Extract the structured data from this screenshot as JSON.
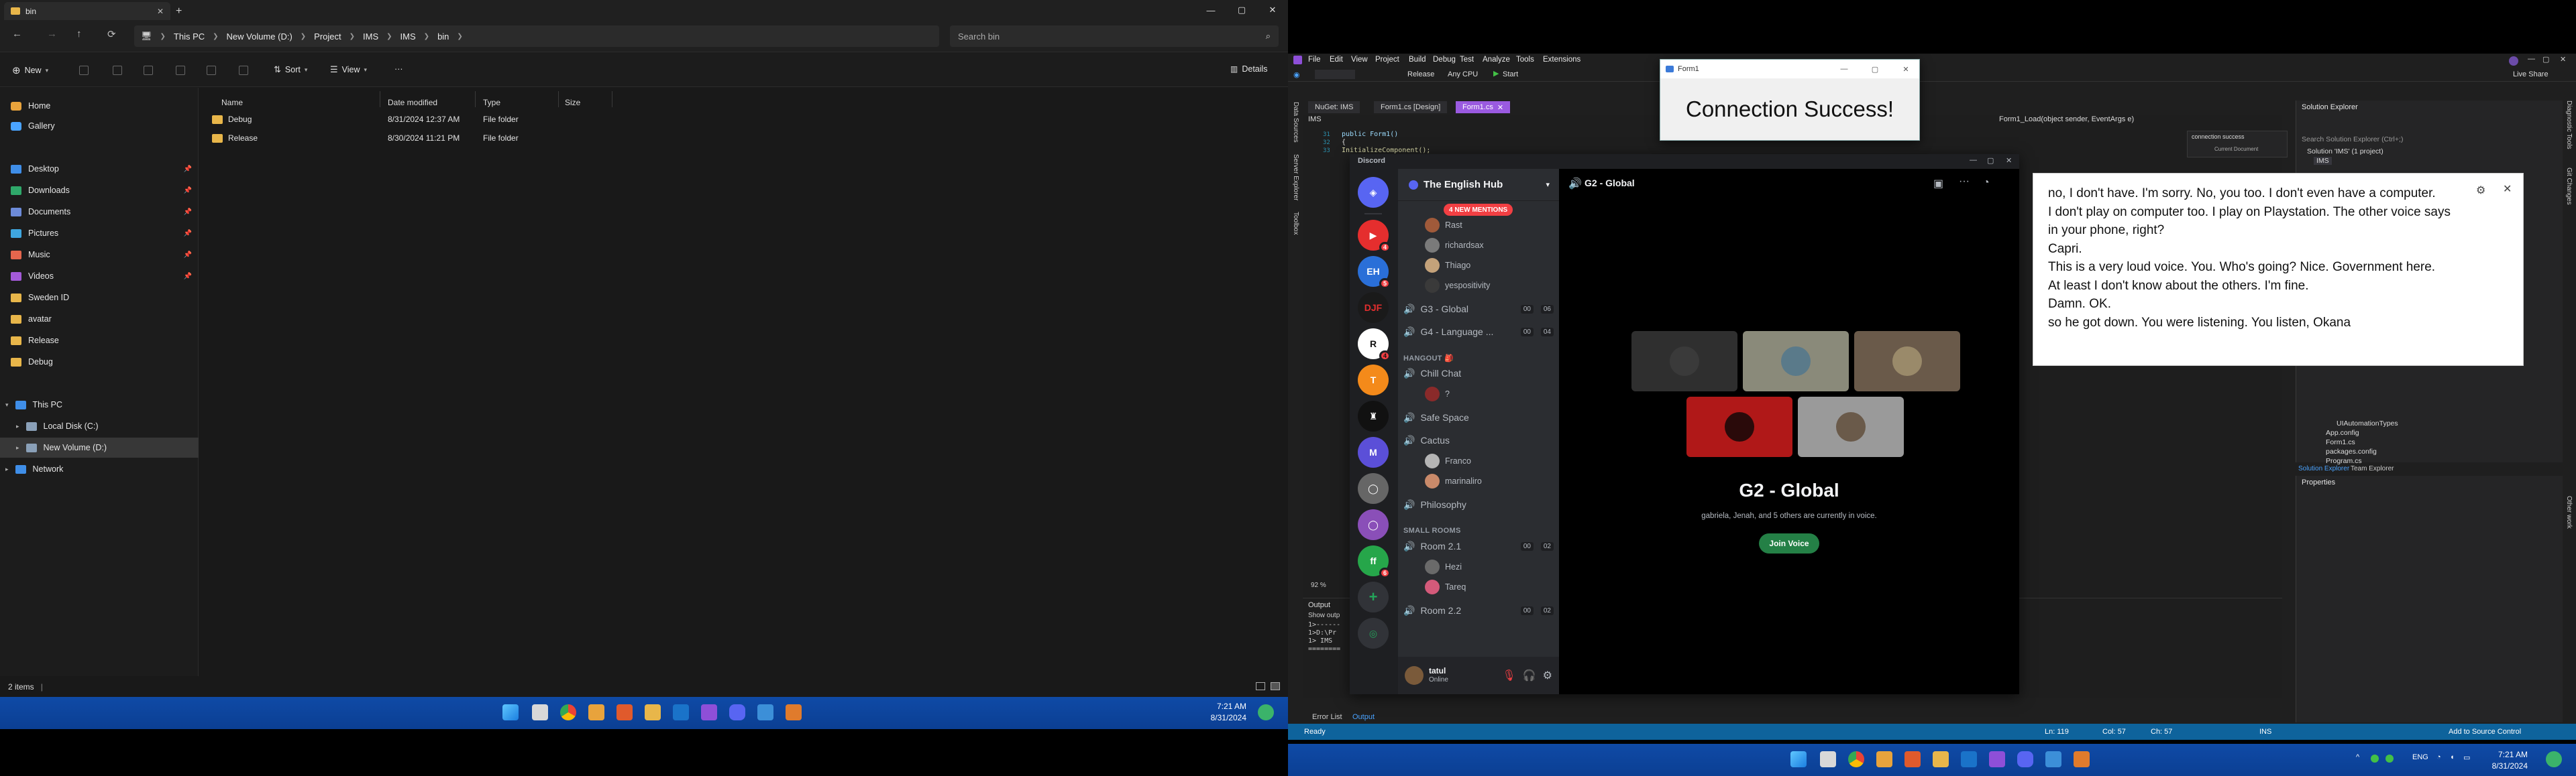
{
  "explorer": {
    "tab_title": "bin",
    "breadcrumbs": [
      "This PC",
      "New Volume (D:)",
      "Project",
      "IMS",
      "IMS",
      "bin"
    ],
    "search_placeholder": "Search bin",
    "toolbar": {
      "new": "New",
      "sort": "Sort",
      "view": "View",
      "more": "···",
      "details": "Details"
    },
    "sidebar": {
      "quick": [
        {
          "label": "Home",
          "color": "#e8a33c",
          "pinned": false
        },
        {
          "label": "Gallery",
          "color": "#4aa3ff",
          "pinned": false
        }
      ],
      "pinned": [
        {
          "label": "Desktop",
          "color": "#3f8ee8",
          "pinned": true
        },
        {
          "label": "Downloads",
          "color": "#2fa86a",
          "pinned": true
        },
        {
          "label": "Documents",
          "color": "#6d8bd9",
          "pinned": true
        },
        {
          "label": "Pictures",
          "color": "#3fa6df",
          "pinned": true
        },
        {
          "label": "Music",
          "color": "#e4664d",
          "pinned": true
        },
        {
          "label": "Videos",
          "color": "#a35ad8",
          "pinned": true
        },
        {
          "label": "Sweden ID",
          "color": "#e8b64a",
          "pinned": false
        },
        {
          "label": "avatar",
          "color": "#e8b64a",
          "pinned": false
        },
        {
          "label": "Release",
          "color": "#e8b64a",
          "pinned": false
        },
        {
          "label": "Debug",
          "color": "#e8b64a",
          "pinned": false
        }
      ],
      "tree": [
        {
          "label": "This PC",
          "level": 0
        },
        {
          "label": "Local Disk (C:)",
          "level": 1
        },
        {
          "label": "New Volume (D:)",
          "level": 1
        },
        {
          "label": "Network",
          "level": 0
        }
      ]
    },
    "columns": [
      "Name",
      "Date modified",
      "Type",
      "Size"
    ],
    "files": [
      {
        "name": "Debug",
        "date": "8/31/2024 12:37 AM",
        "type": "File folder",
        "size": ""
      },
      {
        "name": "Release",
        "date": "8/30/2024 11:21 PM",
        "type": "File folder",
        "size": ""
      }
    ],
    "status": "2 items"
  },
  "taskbar_left": {
    "time": "7:21 AM",
    "date": "8/31/2024"
  },
  "taskbar_right": {
    "time": "7:21 AM",
    "date": "8/31/2024",
    "lang": "ENG"
  },
  "vs": {
    "menus": [
      "File",
      "Edit",
      "View",
      "Project",
      "Build",
      "Debug",
      "Test",
      "Analyze",
      "Tools",
      "Extensions"
    ],
    "toolbar": {
      "config": "Release",
      "platform": "Any CPU",
      "start": "Start",
      "live_share": "Live Share"
    },
    "doc_tabs": [
      "NuGet: IMS",
      "Form1.cs [Design]",
      "Form1.cs"
    ],
    "class_dropdown": "IMS",
    "method_dropdown": "Form1_Load(object sender, EventArgs e)",
    "code_lines": [
      "public Form1()",
      "{",
      "    InitializeComponent();"
    ],
    "line_numbers": [
      "31",
      "32",
      "33"
    ],
    "zoom": "92 %",
    "output_title": "Output",
    "output_show": "Show outp",
    "output_lines": [
      "1>------",
      "1>D:\\Pr",
      "1>  IMS",
      "========"
    ],
    "bottom_tabs": [
      "Error List",
      "Output"
    ],
    "solution": {
      "title": "Solution Explorer",
      "search": "Search Solution Explorer (Ctrl+;)",
      "root": "Solution 'IMS' (1 project)",
      "project": "IMS",
      "items": [
        "UIAutomationTypes",
        "App.config",
        "Form1.cs",
        "packages.config",
        "Program.cs"
      ],
      "tabs": [
        "Solution Explorer",
        "Team Explorer"
      ]
    },
    "find": {
      "text": "connection success",
      "scope": "Current Document"
    },
    "properties_title": "Properties",
    "status": {
      "ready": "Ready",
      "ln": "Ln: 119",
      "col": "Col: 57",
      "ch": "Ch: 57",
      "ins": "INS",
      "source": "Add to Source Control"
    },
    "side_tabs": [
      "Data Sources",
      "Server Explorer",
      "Toolbox"
    ],
    "right_side_tabs": [
      "Diagnostic Tools",
      "Git Changes",
      "Other work"
    ]
  },
  "form1": {
    "title": "Form1",
    "message": "Connection Success!"
  },
  "discord": {
    "app_title": "Discord",
    "server_name": "The English Hub",
    "new_mentions": "4 NEW MENTIONS",
    "top_users": [
      "Rast",
      "richardsax",
      "Thiago",
      "yespositivity"
    ],
    "channels": [
      {
        "name": "G3 - Global",
        "a": "00",
        "b": "06"
      },
      {
        "name": "G4 - Language ...",
        "a": "00",
        "b": "04"
      }
    ],
    "category_hangout": "HANGOUT 🎒",
    "chill_chat": "Chill Chat",
    "chill_user": "?",
    "safe_space": "Safe Space",
    "cactus": "Cactus",
    "cactus_users": [
      "Franco",
      "marinaliro"
    ],
    "philosophy": "Philosophy",
    "category_small": "SMALL ROOMS",
    "room21": {
      "name": "Room 2.1",
      "a": "00",
      "b": "02"
    },
    "room21_users": [
      "Hezi",
      "Tareq"
    ],
    "room22": {
      "name": "Room 2.2",
      "a": "00",
      "b": "02"
    },
    "user": {
      "name": "tatul",
      "status": "Online"
    },
    "guild_badges": [
      "4",
      "5",
      "4",
      "6"
    ],
    "stage": {
      "channel": "G2 - Global",
      "title": "G2 - Global",
      "subtitle": "gabriela, Jenah, and 5 others are currently in voice.",
      "join": "Join Voice"
    }
  },
  "captions": {
    "lines": [
      "no, I don't have. I'm sorry. No, you too. I don't even have a computer.",
      "I don't play on computer too. I play on Playstation. The other voice says in your phone, right?",
      "Capri.",
      "This is a very loud voice. You. Who's going? Nice. Government here.",
      "At least I don't know about the others. I'm fine.",
      "Damn. OK.",
      "so he got down. You were listening. You listen, Okana"
    ]
  }
}
